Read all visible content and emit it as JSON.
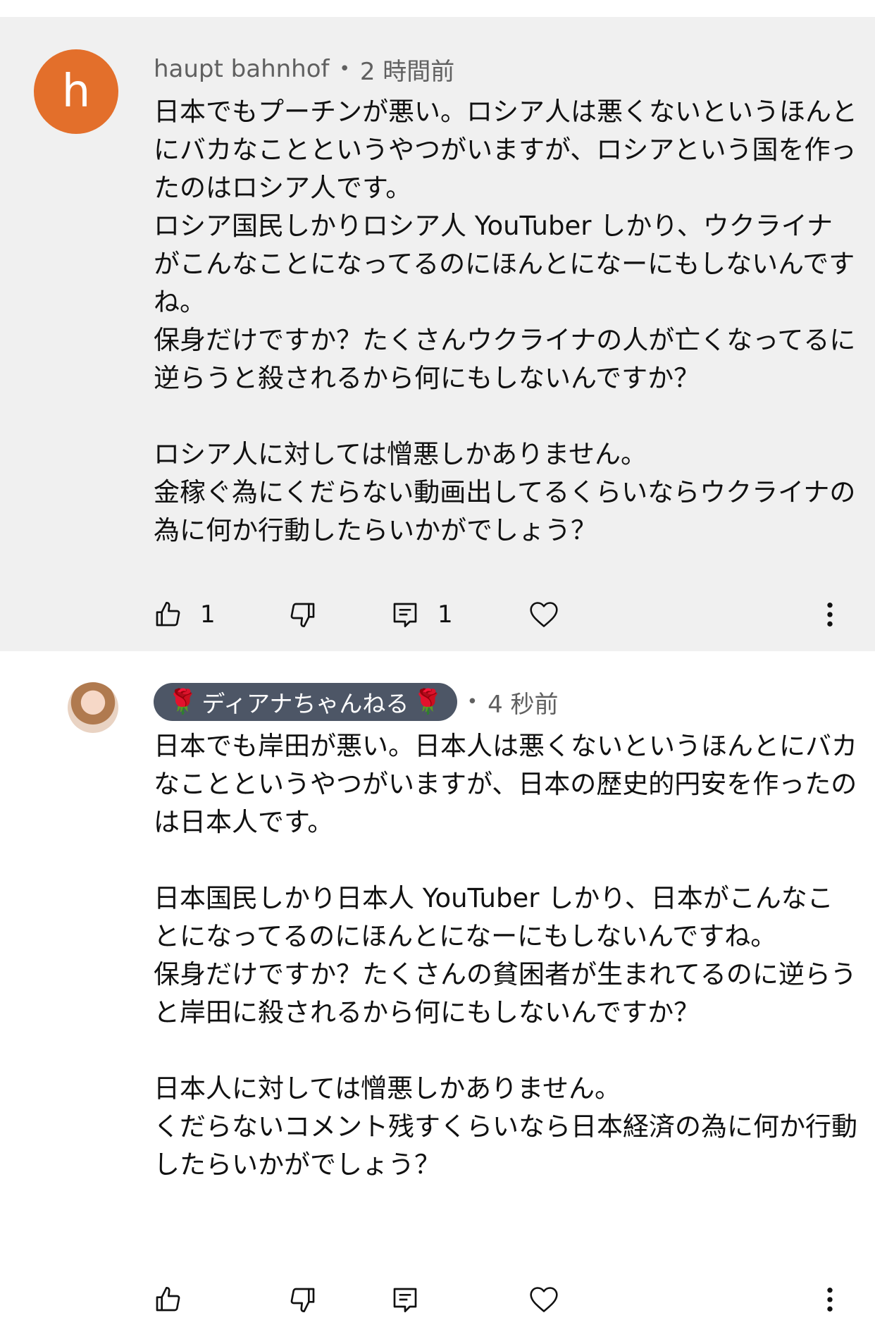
{
  "comments": [
    {
      "avatar_letter": "h",
      "author": "haupt bahnhof",
      "separator": "•",
      "time": "2 時間前",
      "text": "日本でもプーチンが悪い。ロシア人は悪くないというほんとにバカなことというやつがいますが、ロシアという国を作ったのはロシア人です。\nロシア国民しかりロシア人 YouTuber しかり、ウクライナがこんなことになってるのにほんとになーにもしないんですね。\n保身だけですか？たくさんウクライナの人が亡くなってるに逆らうと殺されるから何にもしないんですか？\n\nロシア人に対しては憎悪しかありません。\n金稼ぐ為にくだらない動画出してるくらいならウクライナの為に何か行動したらいかがでしょう？",
      "likes": "1",
      "replies": "1",
      "avatar_color": "#e36f2b",
      "background": "#f0f0f0"
    },
    {
      "author": "ディアナちゃんねる",
      "author_decoration": "🌹",
      "separator": "•",
      "time": "4 秒前",
      "text": "日本でも岸田が悪い。日本人は悪くないというほんとにバカなことというやつがいますが、日本の歴史的円安を作ったのは日本人です。\n\n日本国民しかり日本人 YouTuber しかり、日本がこんなことになってるのにほんとになーにもしないんですね。\n保身だけですか？たくさんの貧困者が生まれてるのに逆らうと岸田に殺されるから何にもしないんですか？\n\n日本人に対しては憎悪しかありません。\nくだらないコメント残すくらいなら日本経済の為に何か行動したらいかがでしょう？",
      "chip_color": "#4d5666",
      "background": "#ffffff"
    }
  ],
  "icons": {
    "like": "thumbs-up-icon",
    "dislike": "thumbs-down-icon",
    "reply": "comment-icon",
    "heart": "heart-icon",
    "more": "more-vertical-icon"
  }
}
